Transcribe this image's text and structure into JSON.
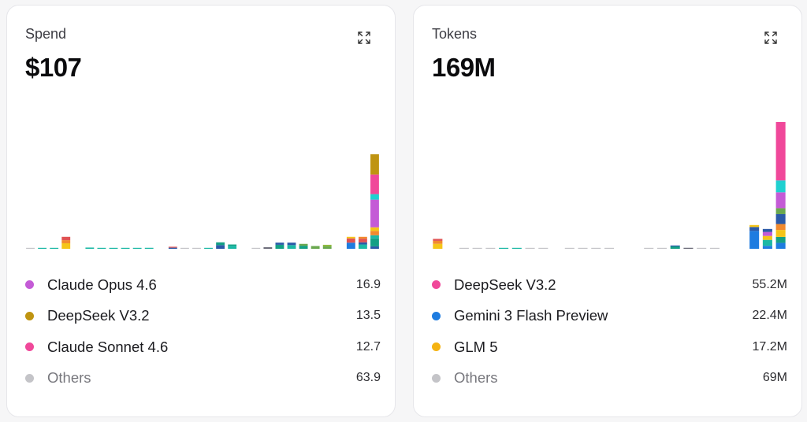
{
  "spend": {
    "label": "Spend",
    "value": "$107",
    "expand_icon": "expand-icon",
    "legend": [
      {
        "name": "Claude Opus 4.6",
        "value": "16.9",
        "color": "#c45bd6"
      },
      {
        "name": "DeepSeek V3.2",
        "value": "13.5",
        "color": "#bf9411"
      },
      {
        "name": "Claude Sonnet 4.6",
        "value": "12.7",
        "color": "#f0489a"
      },
      {
        "name": "Others",
        "value": "63.9",
        "color": "#c4c4c8"
      }
    ],
    "chart_data": {
      "type": "bar",
      "stacked": true,
      "grid": false,
      "ymax": 20,
      "bars": [
        [
          {
            "c": "#c4c4c8",
            "v": 0.05
          }
        ],
        [
          {
            "c": "#1bb8a5",
            "v": 0.12
          }
        ],
        [
          {
            "c": "#1bb8a5",
            "v": 0.1
          }
        ],
        [
          {
            "c": "#f5c518",
            "v": 0.9
          },
          {
            "c": "#f28a2e",
            "v": 0.5
          },
          {
            "c": "#e05252",
            "v": 0.55
          }
        ],
        [],
        [
          {
            "c": "#1bb8a5",
            "v": 0.2
          }
        ],
        [
          {
            "c": "#1bb8a5",
            "v": 0.12
          }
        ],
        [
          {
            "c": "#1bb8a5",
            "v": 0.15
          }
        ],
        [
          {
            "c": "#1bb8a5",
            "v": 0.14
          }
        ],
        [
          {
            "c": "#1bb8a5",
            "v": 0.15
          }
        ],
        [
          {
            "c": "#1bb8a5",
            "v": 0.16
          }
        ],
        [],
        [
          {
            "c": "#2b5aa8",
            "v": 0.18
          },
          {
            "c": "#e05252",
            "v": 0.12
          }
        ],
        [
          {
            "c": "#c4c4c8",
            "v": 0.06
          }
        ],
        [
          {
            "c": "#c4c4c8",
            "v": 0.05
          }
        ],
        [
          {
            "c": "#1bb8a5",
            "v": 0.12
          }
        ],
        [
          {
            "c": "#2b5aa8",
            "v": 0.6
          },
          {
            "c": "#14a085",
            "v": 0.45
          }
        ],
        [
          {
            "c": "#1bb8a5",
            "v": 0.5
          },
          {
            "c": "#14a085",
            "v": 0.2
          }
        ],
        [],
        [
          {
            "c": "#c4c4c8",
            "v": 0.05
          }
        ],
        [
          {
            "c": "#6b6b78",
            "v": 0.25
          }
        ],
        [
          {
            "c": "#14a085",
            "v": 0.65
          },
          {
            "c": "#2b5aa8",
            "v": 0.35
          }
        ],
        [
          {
            "c": "#1bb8a5",
            "v": 0.6
          },
          {
            "c": "#2b5aa8",
            "v": 0.4
          }
        ],
        [
          {
            "c": "#14a085",
            "v": 0.5
          },
          {
            "c": "#6aa84f",
            "v": 0.3
          }
        ],
        [
          {
            "c": "#6aa84f",
            "v": 0.45
          }
        ],
        [
          {
            "c": "#6aa84f",
            "v": 0.4
          },
          {
            "c": "#8bb83a",
            "v": 0.25
          }
        ],
        [],
        [
          {
            "c": "#1e7ce0",
            "v": 1.0
          },
          {
            "c": "#e05252",
            "v": 0.7
          },
          {
            "c": "#f5c518",
            "v": 0.25
          }
        ],
        [
          {
            "c": "#1bb8a5",
            "v": 0.7
          },
          {
            "c": "#2b5aa8",
            "v": 0.35
          },
          {
            "c": "#e05252",
            "v": 0.6
          },
          {
            "c": "#f28a2e",
            "v": 0.3
          }
        ],
        [
          {
            "c": "#2b5aa8",
            "v": 0.4
          },
          {
            "c": "#14a085",
            "v": 1.3
          },
          {
            "c": "#1bb8a5",
            "v": 0.5
          },
          {
            "c": "#f28a2e",
            "v": 0.7
          },
          {
            "c": "#f5c518",
            "v": 0.6
          },
          {
            "c": "#c45bd6",
            "v": 4.5
          },
          {
            "c": "#1fd0d0",
            "v": 0.9
          },
          {
            "c": "#f0489a",
            "v": 3.2
          },
          {
            "c": "#bf9411",
            "v": 3.3
          }
        ]
      ]
    }
  },
  "tokens": {
    "label": "Tokens",
    "value": "169M",
    "expand_icon": "expand-icon",
    "legend": [
      {
        "name": "DeepSeek V3.2",
        "value": "55.2M",
        "color": "#f0489a"
      },
      {
        "name": "Gemini 3 Flash Preview",
        "value": "22.4M",
        "color": "#1e7ce0"
      },
      {
        "name": "GLM 5",
        "value": "17.2M",
        "color": "#f5b312"
      },
      {
        "name": "Others",
        "value": "69M",
        "color": "#c4c4c8"
      }
    ],
    "chart_data": {
      "type": "bar",
      "stacked": true,
      "grid": false,
      "ymax": 62,
      "bars": [
        [
          {
            "c": "#f5c518",
            "v": 2.5
          },
          {
            "c": "#f28a2e",
            "v": 1.5
          },
          {
            "c": "#e05252",
            "v": 1.0
          }
        ],
        [],
        [
          {
            "c": "#c4c4c8",
            "v": 0.2
          }
        ],
        [
          {
            "c": "#c4c4c8",
            "v": 0.2
          }
        ],
        [
          {
            "c": "#c4c4c8",
            "v": 0.2
          }
        ],
        [
          {
            "c": "#1bb8a5",
            "v": 0.4
          }
        ],
        [
          {
            "c": "#1bb8a5",
            "v": 0.3
          }
        ],
        [
          {
            "c": "#c4c4c8",
            "v": 0.2
          }
        ],
        [
          {
            "c": "#c4c4c8",
            "v": 0.15
          }
        ],
        [],
        [
          {
            "c": "#c4c4c8",
            "v": 0.2
          }
        ],
        [
          {
            "c": "#c4c4c8",
            "v": 0.2
          }
        ],
        [
          {
            "c": "#c4c4c8",
            "v": 0.2
          }
        ],
        [
          {
            "c": "#c4c4c8",
            "v": 0.2
          }
        ],
        [],
        [],
        [
          {
            "c": "#c4c4c8",
            "v": 0.3
          }
        ],
        [
          {
            "c": "#c4c4c8",
            "v": 0.3
          }
        ],
        [
          {
            "c": "#14a085",
            "v": 1.2
          },
          {
            "c": "#2b5aa8",
            "v": 0.4
          }
        ],
        [
          {
            "c": "#6b6b78",
            "v": 0.5
          }
        ],
        [
          {
            "c": "#c4c4c8",
            "v": 0.2
          }
        ],
        [
          {
            "c": "#c4c4c8",
            "v": 0.2
          }
        ],
        [],
        [],
        [
          {
            "c": "#1e7ce0",
            "v": 9.0
          },
          {
            "c": "#2b5aa8",
            "v": 2.0
          },
          {
            "c": "#f5c518",
            "v": 1.0
          }
        ],
        [
          {
            "c": "#1e7ce0",
            "v": 1.5
          },
          {
            "c": "#1bb8a5",
            "v": 3.0
          },
          {
            "c": "#f5c518",
            "v": 2.0
          },
          {
            "c": "#c45bd6",
            "v": 2.0
          },
          {
            "c": "#2b5aa8",
            "v": 1.5
          }
        ],
        [
          {
            "c": "#1e7ce0",
            "v": 3.0
          },
          {
            "c": "#14a085",
            "v": 3.0
          },
          {
            "c": "#f5c518",
            "v": 3.5
          },
          {
            "c": "#f28a2e",
            "v": 3.0
          },
          {
            "c": "#2b5aa8",
            "v": 5.0
          },
          {
            "c": "#6aa84f",
            "v": 3.0
          },
          {
            "c": "#c45bd6",
            "v": 8.0
          },
          {
            "c": "#1fd0d0",
            "v": 6.0
          },
          {
            "c": "#f0489a",
            "v": 36.0
          }
        ]
      ]
    }
  }
}
